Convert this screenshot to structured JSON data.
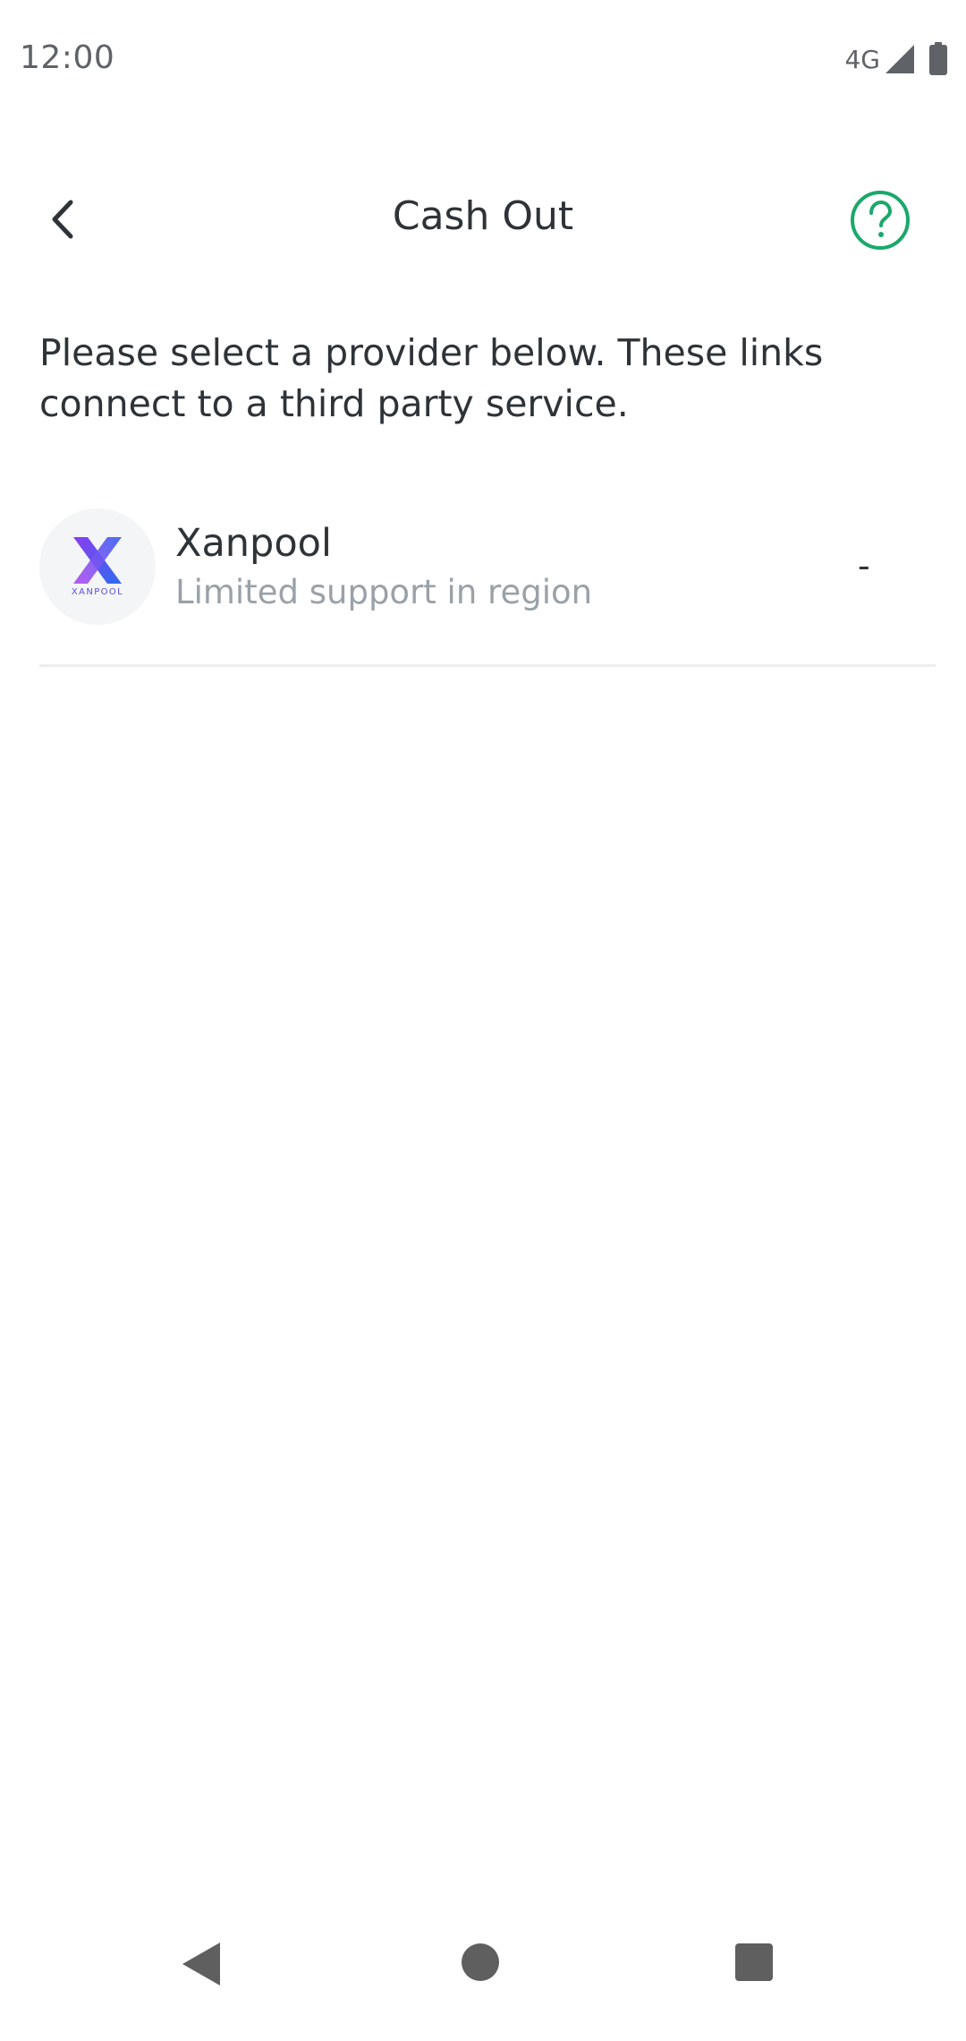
{
  "status_bar": {
    "time": "12:00",
    "network": "4G",
    "icons": [
      "signal-icon",
      "battery-icon"
    ]
  },
  "header": {
    "title": "Cash Out",
    "back_icon": "chevron-left-icon",
    "help_icon": "help-circle-icon"
  },
  "intro": {
    "text": "Please select a provider below. These links connect to a third party service."
  },
  "providers": [
    {
      "name": "Xanpool",
      "status": "Limited support in region",
      "value": "-",
      "logo_wordmark": "XANPOOL"
    }
  ],
  "nav_bar": {
    "icons": [
      "nav-back-icon",
      "nav-home-icon",
      "nav-recents-icon"
    ]
  },
  "colors": {
    "accent": "#1aa86b",
    "text_primary": "#2e3338",
    "text_secondary": "#9aa1a8",
    "divider": "#eceef0",
    "logo_gradient_start": "#8a3df0",
    "logo_gradient_end": "#2f6bf0"
  }
}
